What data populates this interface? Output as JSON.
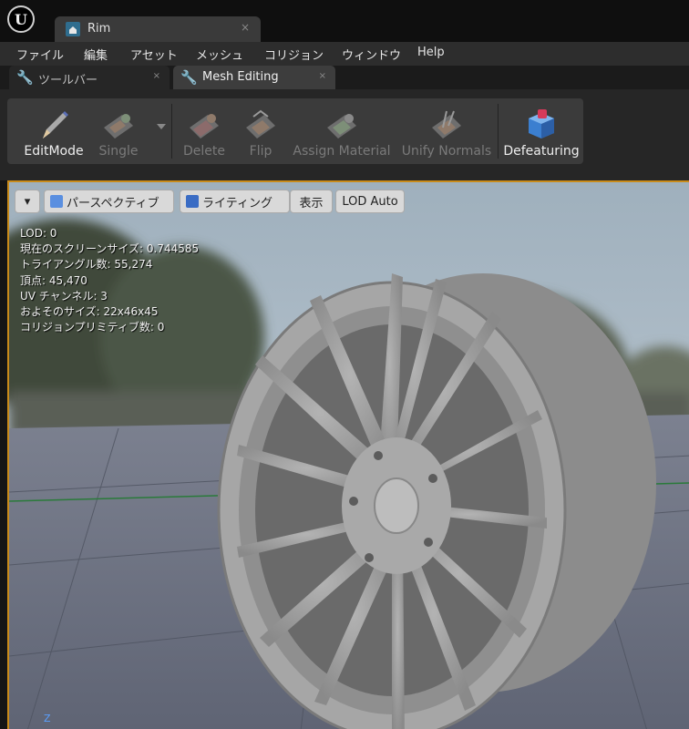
{
  "window": {
    "logo": "U",
    "doc_tab": {
      "title": "Rim",
      "close": "×"
    }
  },
  "menu": [
    "ファイル",
    "編集",
    "アセット",
    "メッシュ",
    "コリジョン",
    "ウィンドウ",
    "Help"
  ],
  "panel_tabs": [
    {
      "label": "ツールバー",
      "close": "×",
      "active": false
    },
    {
      "label": "Mesh Editing",
      "close": "×",
      "active": true
    }
  ],
  "toolbar": {
    "buttons": [
      {
        "label": "EditMode",
        "enabled": true,
        "icon": "pencil-icon"
      },
      {
        "label": "Single",
        "enabled": false,
        "icon": "select-single-icon"
      },
      {
        "label": "Delete",
        "enabled": false,
        "icon": "delete-icon"
      },
      {
        "label": "Flip",
        "enabled": false,
        "icon": "flip-icon"
      },
      {
        "label": "Assign Material",
        "enabled": false,
        "icon": "assign-material-icon"
      },
      {
        "label": "Unify Normals",
        "enabled": false,
        "icon": "unify-normals-icon"
      },
      {
        "label": "Defeaturing",
        "enabled": true,
        "icon": "defeaturing-icon"
      }
    ]
  },
  "viewport": {
    "buttons": {
      "menu": "▾",
      "perspective": "パースペクティブ",
      "lighting": "ライティング",
      "show": "表示",
      "lod": "LOD Auto"
    },
    "stats": [
      "LOD: 0",
      "現在のスクリーンサイズ: 0.744585",
      "トライアングル数: 55,274",
      "頂点: 45,470",
      "UV チャンネル: 3",
      "およそのサイズ: 22x46x45",
      "コリジョンプリミティブ数: 0"
    ],
    "axis_label": "Z"
  },
  "colors": {
    "viewport_border": "#c98b1a",
    "wheel": "#9a9a9a",
    "floor": "#6f7485",
    "sky": "#aebdc9"
  }
}
